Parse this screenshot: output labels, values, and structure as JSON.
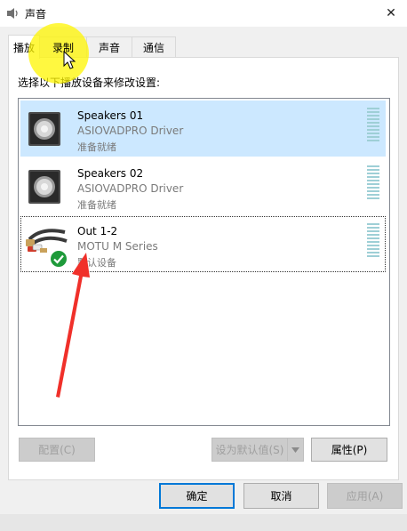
{
  "window": {
    "title": "声音",
    "close_glyph": "✕"
  },
  "tabs": [
    {
      "label": "播放",
      "active": true
    },
    {
      "label": "录制",
      "active": false
    },
    {
      "label": "声音",
      "active": false
    },
    {
      "label": "通信",
      "active": false
    }
  ],
  "instruction": "选择以下播放设备来修改设置:",
  "devices": [
    {
      "name": "Speakers 01",
      "driver": "ASIOVADPRO Driver",
      "status": "准备就绪",
      "icon": "speaker-icon",
      "selected": true
    },
    {
      "name": "Speakers 02",
      "driver": "ASIOVADPRO Driver",
      "status": "准备就绪",
      "icon": "speaker-icon",
      "selected": false
    },
    {
      "name": "Out 1-2",
      "driver": "MOTU M Series",
      "status": "默认设备",
      "icon": "rca-cable-icon",
      "default": true,
      "focused": true
    }
  ],
  "buttons": {
    "configure": "配置(C)",
    "set_default": "设为默认值(S)",
    "properties": "属性(P)",
    "ok": "确定",
    "cancel": "取消",
    "apply": "应用(A)"
  },
  "colors": {
    "selection": "#cce8ff",
    "accent": "#0078d7",
    "default_badge": "#1e9a3a",
    "annotation_arrow": "#f0302a",
    "cursor_highlight": "#fff500"
  }
}
